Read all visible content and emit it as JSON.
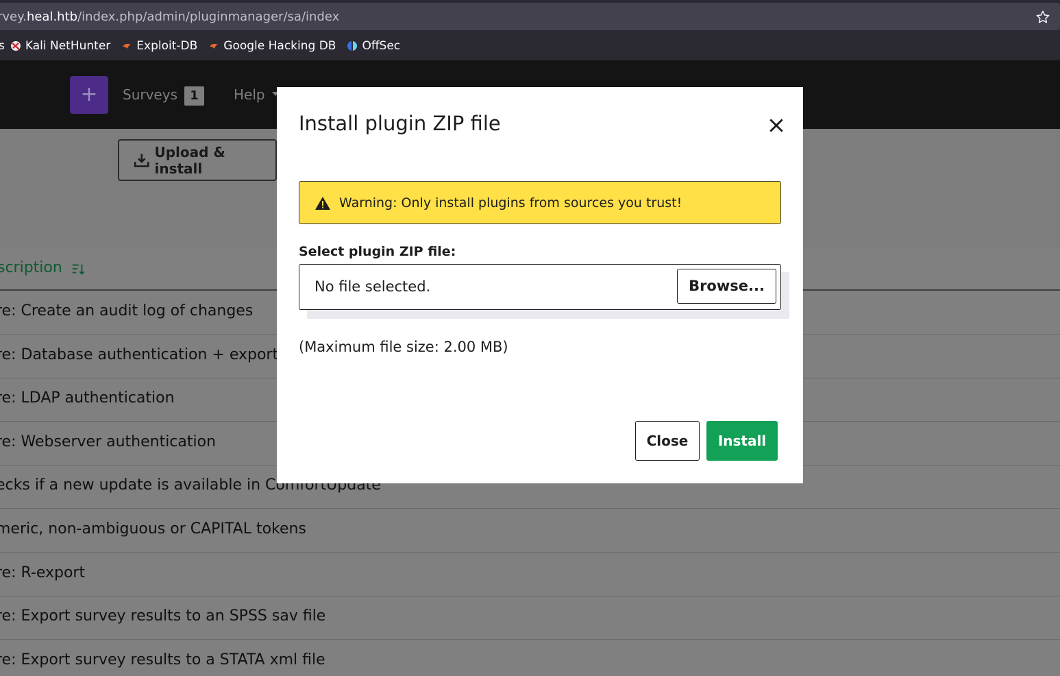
{
  "browser": {
    "url_prefix": "rvey.",
    "url_host": "heal.htb",
    "url_path": "/index.php/admin/pluginmanager/sa/index",
    "bookmarks": [
      {
        "label": "s",
        "icon": "none"
      },
      {
        "label": "Kali NetHunter",
        "icon": "nethunter-icon"
      },
      {
        "label": "Exploit-DB",
        "icon": "exploitdb-icon"
      },
      {
        "label": "Google Hacking DB",
        "icon": "ghdb-icon"
      },
      {
        "label": "OffSec",
        "icon": "offsec-icon"
      }
    ]
  },
  "header": {
    "plus_label": "+",
    "surveys_label": "Surveys",
    "surveys_count": "1",
    "help_label": "Help"
  },
  "toolbar": {
    "upload_label": "Upload & install"
  },
  "table": {
    "description_header": "scription",
    "rows": [
      "re: Create an audit log of changes",
      "re: Database authentication + exports",
      "re: LDAP authentication",
      "re: Webserver authentication",
      "ecks if a new update is available in ComfortUpdate",
      "meric, non-ambiguous or CAPITAL tokens",
      "re: R-export",
      "re: Export survey results to an SPSS sav file",
      "re: Export survey results to a STATA xml file"
    ]
  },
  "modal": {
    "title": "Install plugin ZIP file",
    "warning": "Warning: Only install plugins from sources you trust!",
    "select_label": "Select plugin ZIP file:",
    "file_status": "No file selected.",
    "browse_label": "Browse...",
    "max_size": "(Maximum file size: 2.00 MB)",
    "close_label": "Close",
    "install_label": "Install"
  },
  "colors": {
    "primary": "#6f3fd1",
    "success": "#13a158",
    "warning": "#ffe046"
  }
}
